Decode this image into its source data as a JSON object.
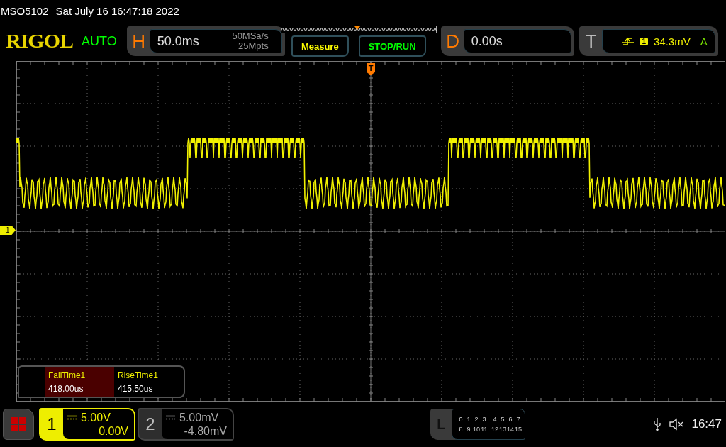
{
  "header": {
    "model": "MSO5102",
    "datetime": "Sat July 16 16:47:18 2022"
  },
  "toolbar": {
    "logo": "RIGOL",
    "trigger_status": "AUTO",
    "horizontal": {
      "label": "H",
      "timebase": "50.0ms",
      "sample_rate": "50MSa/s",
      "memory_depth": "25Mpts"
    },
    "buttons": [
      {
        "label": "Measure",
        "color": "#ffff00"
      },
      {
        "label": "STOP/RUN",
        "color": "#00ff00"
      }
    ],
    "delay": {
      "label": "D",
      "value": "0.00s"
    },
    "trigger": {
      "label": "T",
      "source": "1",
      "level": "34.3mV",
      "mode": "A"
    }
  },
  "screen": {
    "trigger_marker": "T",
    "channel_marker": "1"
  },
  "measurements": [
    {
      "name": "FallTime1",
      "value": "418.00us",
      "selected": true
    },
    {
      "name": "RiseTime1",
      "value": "415.50us",
      "selected": false
    }
  ],
  "channels": [
    {
      "number": "1",
      "scale": "5.00V",
      "offset": "0.00V",
      "selected": true
    },
    {
      "number": "2",
      "scale": "5.00mV",
      "offset": "-4.80mV",
      "selected": false
    }
  ],
  "logic": {
    "label": "L",
    "rows": [
      [
        "0",
        "1",
        "2",
        "3",
        "4",
        "5",
        "6",
        "7"
      ],
      [
        "8",
        "9",
        "10",
        "11",
        "12",
        "13",
        "14",
        "15"
      ]
    ]
  },
  "status": {
    "time": "16:47"
  }
}
